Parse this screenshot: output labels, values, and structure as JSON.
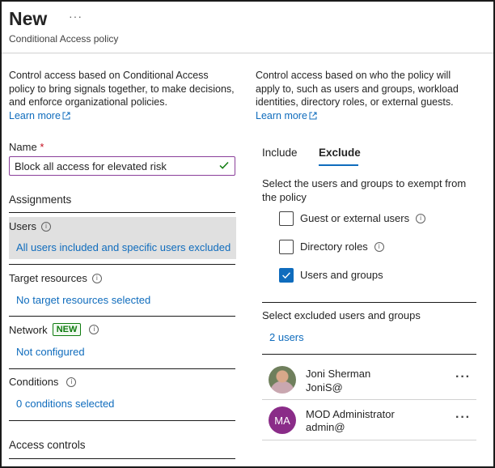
{
  "header": {
    "title": "New",
    "more_label": "···",
    "subtitle": "Conditional Access policy"
  },
  "left": {
    "description": "Control access based on Conditional Access policy to bring signals together, to make decisions, and enforce organizational policies.",
    "learn_more": "Learn more",
    "name_label": "Name",
    "name_required": "*",
    "name_value": "Block all access for elevated risk",
    "assignments_heading": "Assignments",
    "rows": [
      {
        "label": "Users",
        "value": "All users included and specific users excluded"
      },
      {
        "label": "Target resources",
        "value": "No target resources selected"
      },
      {
        "label": "Network",
        "badge": "NEW",
        "value": "Not configured"
      },
      {
        "label": "Conditions",
        "value": "0 conditions selected"
      }
    ],
    "access_controls_heading": "Access controls"
  },
  "right": {
    "description": "Control access based on who the policy will apply to, such as users and groups, workload identities, directory roles, or external guests.",
    "learn_more": "Learn more",
    "tabs": [
      {
        "label": "Include",
        "active": false
      },
      {
        "label": "Exclude",
        "active": true
      }
    ],
    "exempt_text": "Select the users and groups to exempt from the policy",
    "checkboxes": [
      {
        "label": "Guest or external users",
        "checked": false,
        "info": true
      },
      {
        "label": "Directory roles",
        "checked": false,
        "info": true
      },
      {
        "label": "Users and groups",
        "checked": true,
        "info": false
      }
    ],
    "excluded_heading": "Select excluded users and groups",
    "excluded_count": "2 users",
    "users": [
      {
        "name": "Joni Sherman",
        "sub": "JoniS@",
        "avatar": "photo",
        "more": "···"
      },
      {
        "name": "MOD Administrator",
        "sub": "admin@",
        "avatar": "MA",
        "more": "···"
      }
    ]
  },
  "colors": {
    "link": "#0f6cbd",
    "required": "#c50f1f",
    "selected_row": "#e0e0e0",
    "badge": "#107c10",
    "avatar_ma": "#8a2c88",
    "checkbox_checked": "#0f6cbd"
  }
}
